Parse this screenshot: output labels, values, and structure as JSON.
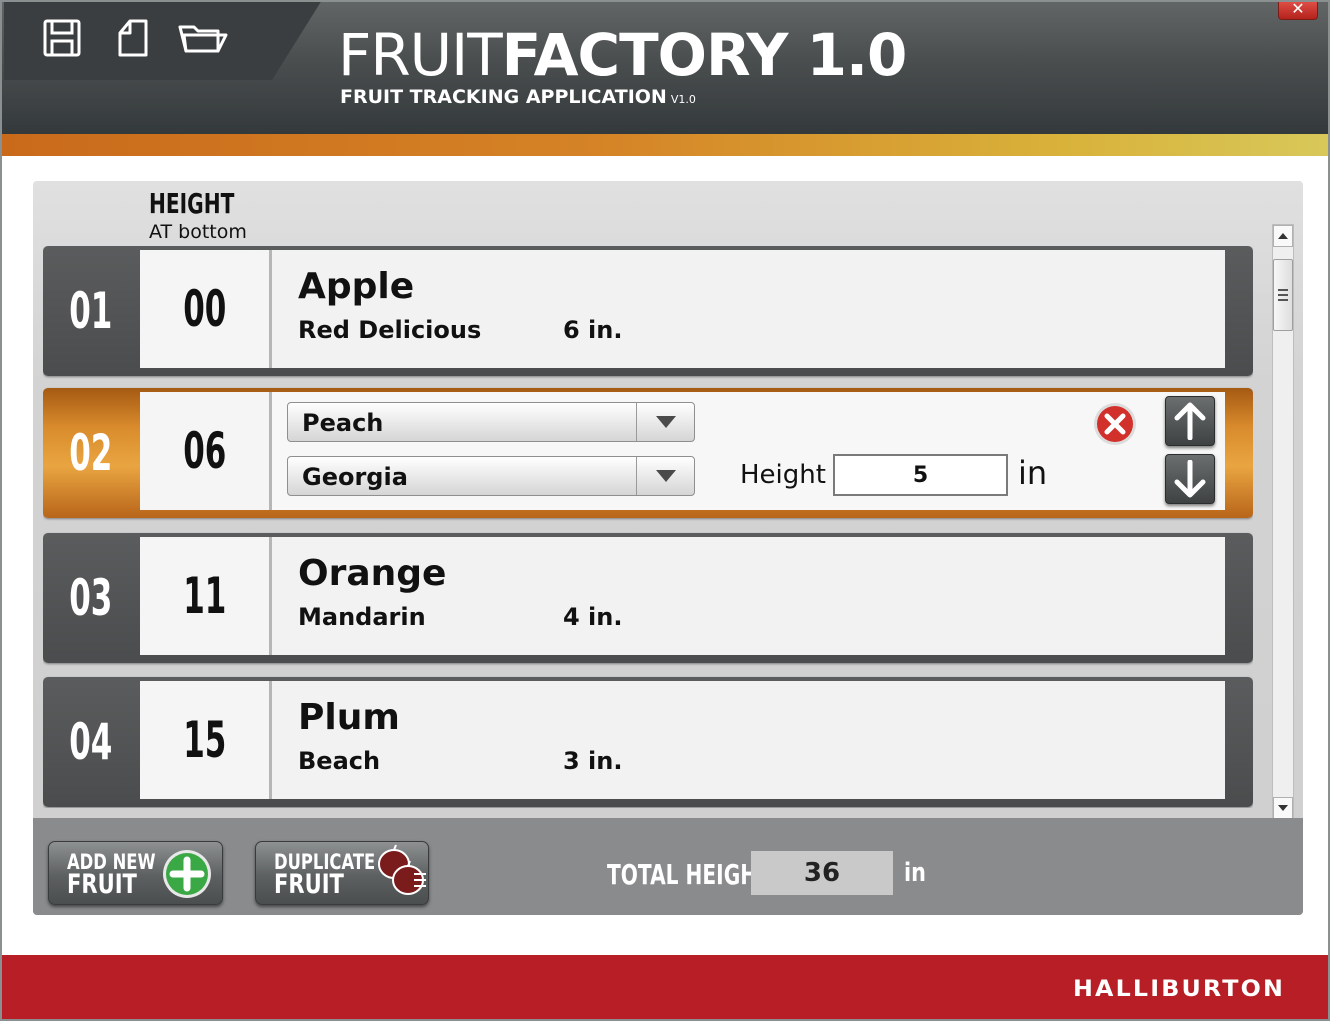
{
  "header": {
    "title_light": "FRUIT",
    "title_bold": "FACTORY 1.0",
    "subtitle": "FRUIT TRACKING APPLICATION",
    "version": "V1.0",
    "close_label": "✕",
    "toolbar_icons": [
      "save-icon",
      "new-file-icon",
      "open-folder-icon"
    ]
  },
  "columns": {
    "height_title": "HEIGHT",
    "height_subtitle": "AT bottom"
  },
  "rows": [
    {
      "index": "01",
      "height": "00",
      "name": "Apple",
      "variety": "Red Delicious",
      "size": "6 in."
    },
    {
      "index": "02",
      "height": "06",
      "name": "Peach",
      "variety": "Georgia",
      "height_label": "Height",
      "height_value": "5",
      "unit": "in",
      "selected": true
    },
    {
      "index": "03",
      "height": "11",
      "name": "Orange",
      "variety": "Mandarin",
      "size": "4 in."
    },
    {
      "index": "04",
      "height": "15",
      "name": "Plum",
      "variety": "Beach",
      "size": "3 in."
    }
  ],
  "actions": {
    "add_line1": "ADD NEW",
    "add_line2": "FRUIT",
    "dup_line1": "DUPLICATE",
    "dup_line2": "FRUIT"
  },
  "totals": {
    "label": "TOTAL HEIGHT",
    "value": "36",
    "unit": "in"
  },
  "footer": {
    "brand": "HALLIBURTON"
  },
  "colors": {
    "accent": "#d58326",
    "brand_red": "#b81e25",
    "header_dark": "#3a3e40"
  }
}
